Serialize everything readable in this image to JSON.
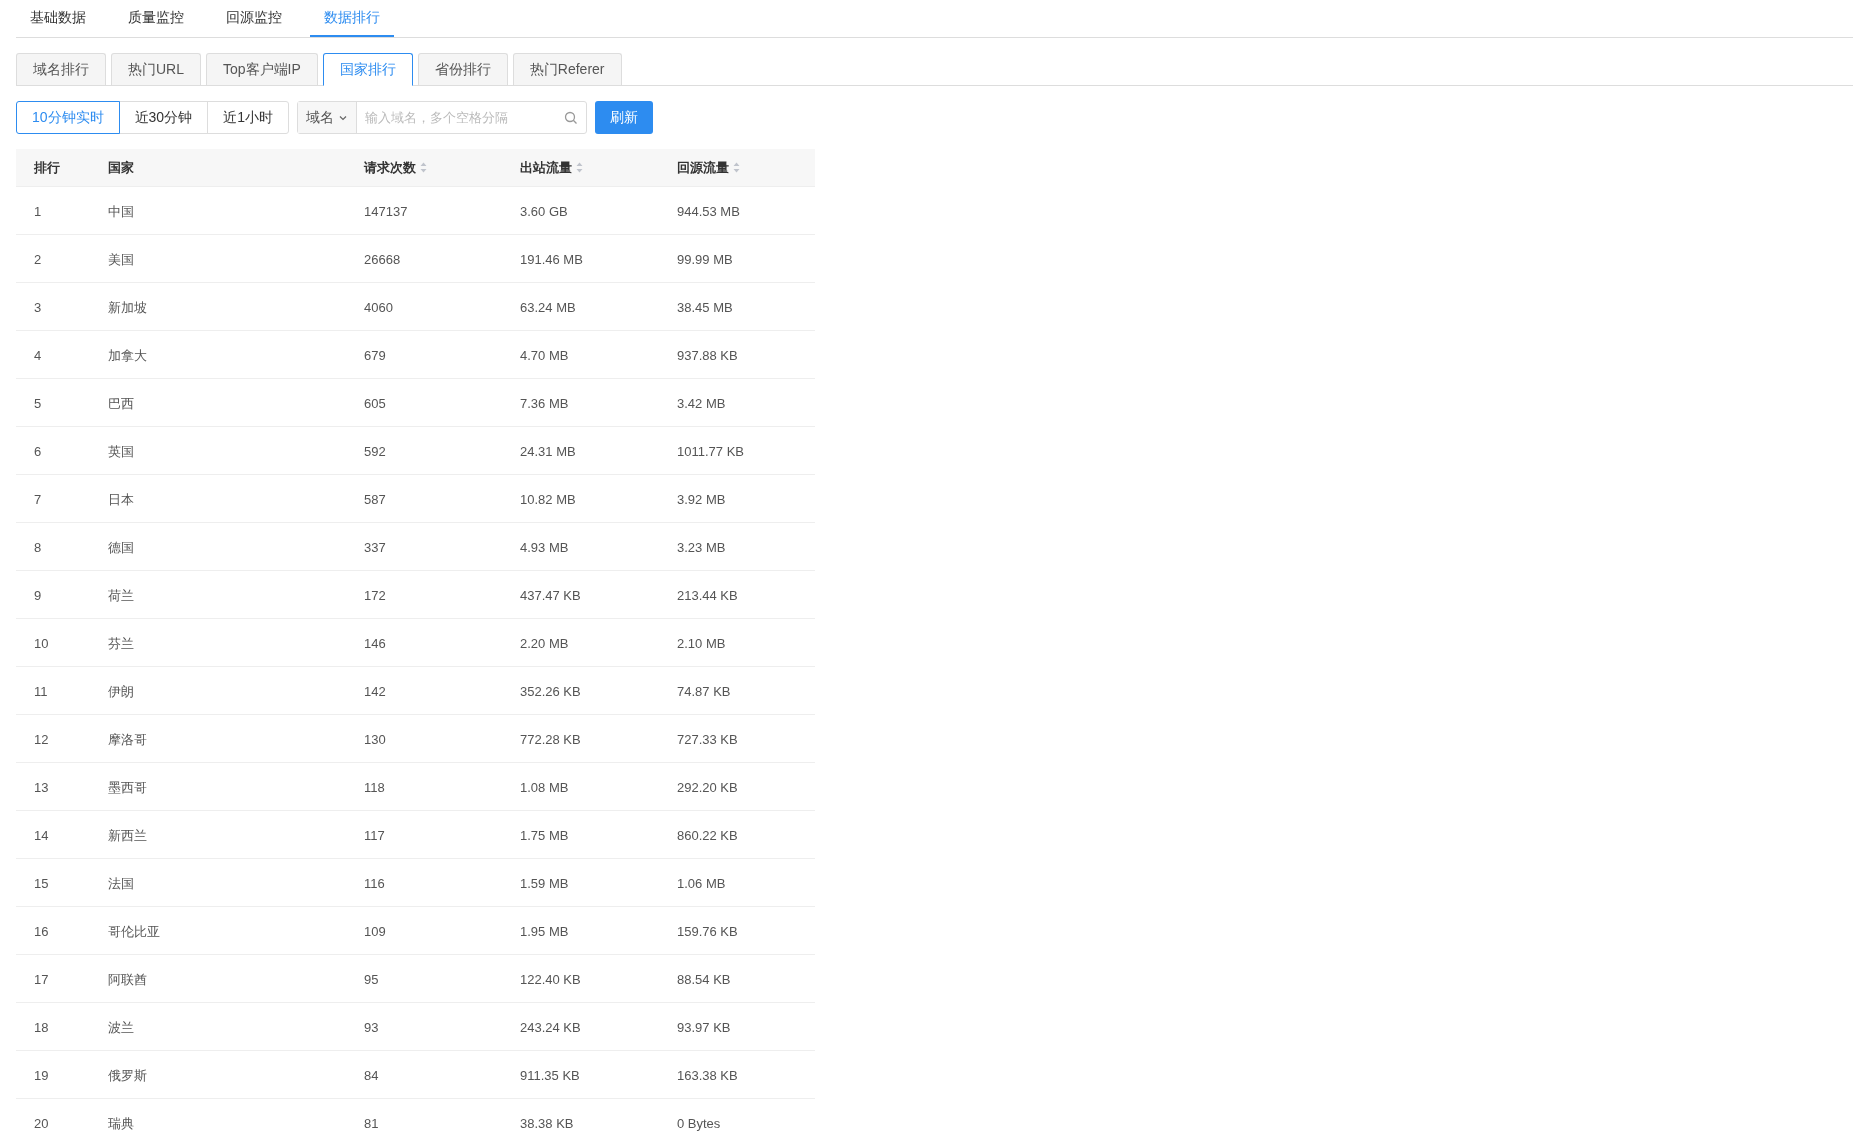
{
  "main_tabs": [
    {
      "label": "基础数据",
      "selected": false
    },
    {
      "label": "质量监控",
      "selected": false
    },
    {
      "label": "回源监控",
      "selected": false
    },
    {
      "label": "数据排行",
      "selected": true
    }
  ],
  "sub_tabs": [
    {
      "label": "域名排行",
      "selected": false
    },
    {
      "label": "热门URL",
      "selected": false
    },
    {
      "label": "Top客户端IP",
      "selected": false
    },
    {
      "label": "国家排行",
      "selected": true
    },
    {
      "label": "省份排行",
      "selected": false
    },
    {
      "label": "热门Referer",
      "selected": false
    }
  ],
  "time_range": [
    {
      "label": "10分钟实时",
      "selected": true
    },
    {
      "label": "近30分钟",
      "selected": false
    },
    {
      "label": "近1小时",
      "selected": false
    }
  ],
  "filter": {
    "type": "域名",
    "placeholder": "输入域名，多个空格分隔"
  },
  "refresh_button": "刷新",
  "table": {
    "columns": [
      {
        "label": "排行",
        "sortable": false
      },
      {
        "label": "国家",
        "sortable": false
      },
      {
        "label": "请求次数",
        "sortable": true
      },
      {
        "label": "出站流量",
        "sortable": true
      },
      {
        "label": "回源流量",
        "sortable": true
      }
    ],
    "rows": [
      [
        "1",
        "中国",
        "147137",
        "3.60 GB",
        "944.53 MB"
      ],
      [
        "2",
        "美国",
        "26668",
        "191.46 MB",
        "99.99 MB"
      ],
      [
        "3",
        "新加坡",
        "4060",
        "63.24 MB",
        "38.45 MB"
      ],
      [
        "4",
        "加拿大",
        "679",
        "4.70 MB",
        "937.88 KB"
      ],
      [
        "5",
        "巴西",
        "605",
        "7.36 MB",
        "3.42 MB"
      ],
      [
        "6",
        "英国",
        "592",
        "24.31 MB",
        "1011.77 KB"
      ],
      [
        "7",
        "日本",
        "587",
        "10.82 MB",
        "3.92 MB"
      ],
      [
        "8",
        "德国",
        "337",
        "4.93 MB",
        "3.23 MB"
      ],
      [
        "9",
        "荷兰",
        "172",
        "437.47 KB",
        "213.44 KB"
      ],
      [
        "10",
        "芬兰",
        "146",
        "2.20 MB",
        "2.10 MB"
      ],
      [
        "11",
        "伊朗",
        "142",
        "352.26 KB",
        "74.87 KB"
      ],
      [
        "12",
        "摩洛哥",
        "130",
        "772.28 KB",
        "727.33 KB"
      ],
      [
        "13",
        "墨西哥",
        "118",
        "1.08 MB",
        "292.20 KB"
      ],
      [
        "14",
        "新西兰",
        "117",
        "1.75 MB",
        "860.22 KB"
      ],
      [
        "15",
        "法国",
        "116",
        "1.59 MB",
        "1.06 MB"
      ],
      [
        "16",
        "哥伦比亚",
        "109",
        "1.95 MB",
        "159.76 KB"
      ],
      [
        "17",
        "阿联酋",
        "95",
        "122.40 KB",
        "88.54 KB"
      ],
      [
        "18",
        "波兰",
        "93",
        "243.24 KB",
        "93.97 KB"
      ],
      [
        "19",
        "俄罗斯",
        "84",
        "911.35 KB",
        "163.38 KB"
      ],
      [
        "20",
        "瑞典",
        "81",
        "38.38 KB",
        "0 Bytes"
      ]
    ]
  }
}
